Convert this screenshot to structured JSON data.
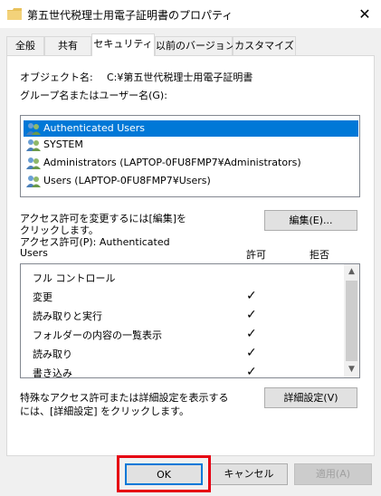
{
  "window": {
    "title": "第五世代税理士用電子証明書のプロパティ",
    "close_glyph": "✕"
  },
  "tabs": [
    {
      "label": "全般"
    },
    {
      "label": "共有"
    },
    {
      "label": "セキュリティ",
      "active": true
    },
    {
      "label": "以前のバージョン"
    },
    {
      "label": "カスタマイズ"
    }
  ],
  "security": {
    "object_label": "オブジェクト名:",
    "object_value": "C:¥第五世代税理士用電子証明書",
    "groups_label": "グループ名またはユーザー名(G):",
    "groups": [
      {
        "name": "Authenticated Users",
        "selected": true
      },
      {
        "name": "SYSTEM"
      },
      {
        "name": "Administrators (LAPTOP-0FU8FMP7¥Administrators)"
      },
      {
        "name": "Users (LAPTOP-0FU8FMP7¥Users)"
      }
    ],
    "change_hint_line1": "アクセス許可を変更するには[編集]を",
    "change_hint_line2": "クリックします。",
    "edit_button": "編集(E)...",
    "permissions_for_line1": "アクセス許可(P): Authenticated",
    "permissions_for_line2": "Users",
    "allow_header": "許可",
    "deny_header": "拒否",
    "permissions": [
      {
        "name": "フル コントロール",
        "allow": false
      },
      {
        "name": "変更",
        "allow": true
      },
      {
        "name": "読み取りと実行",
        "allow": true
      },
      {
        "name": "フォルダーの内容の一覧表示",
        "allow": true
      },
      {
        "name": "読み取り",
        "allow": true
      },
      {
        "name": "書き込み",
        "allow": true
      }
    ],
    "check_glyph": "✓",
    "scroll_up_glyph": "▲",
    "scroll_down_glyph": "▼",
    "advanced_hint_line1": "特殊なアクセス許可または詳細設定を表示する",
    "advanced_hint_line2": "には、[詳細設定] をクリックします。",
    "advanced_button": "詳細設定(V)"
  },
  "footer": {
    "ok": "OK",
    "cancel": "キャンセル",
    "apply": "適用(A)"
  },
  "colors": {
    "selection": "#0078d7",
    "highlight_box": "#e60012",
    "folder": "#e8c15a"
  }
}
